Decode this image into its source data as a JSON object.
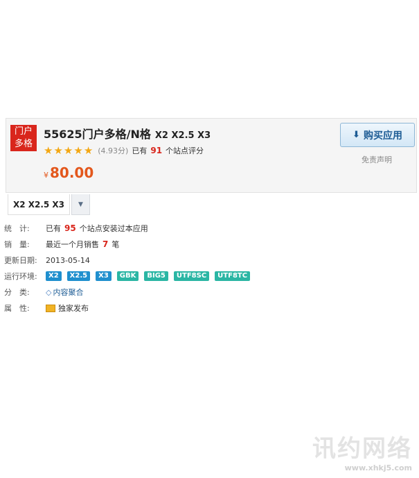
{
  "header": {
    "badge_lines": [
      "门户",
      "多格"
    ],
    "title": "55625门户多格/N格",
    "versions": "X2 X2.5 X3",
    "rating": {
      "stars": 5,
      "score_text": "(4.93分)",
      "prefix": "已有",
      "count": "91",
      "suffix": "个站点评分"
    },
    "price_currency": "¥",
    "price": "80.00",
    "buy_label": "购买应用",
    "buy_icon": "download-icon",
    "disclaimer": "免责声明"
  },
  "version_tab": {
    "label": "X2 X2.5 X3",
    "dropdown_icon": "chevron-down-icon"
  },
  "info": {
    "stats": {
      "label": "统　计:",
      "prefix": "已有",
      "count": "95",
      "suffix": "个站点安装过本应用"
    },
    "sales": {
      "label": "销　量:",
      "prefix": "最近一个月销售",
      "count": "7",
      "suffix": "笔"
    },
    "updated": {
      "label": "更新日期:",
      "value": "2013-05-14"
    },
    "env": {
      "label": "运行环境:",
      "tags": [
        {
          "text": "X2",
          "color": "#1f8fce"
        },
        {
          "text": "X2.5",
          "color": "#1f8fce"
        },
        {
          "text": "X3",
          "color": "#1f8fce"
        },
        {
          "text": "GBK",
          "color": "#2bb6a4"
        },
        {
          "text": "BIG5",
          "color": "#2bb6a4"
        },
        {
          "text": "UTF8SC",
          "color": "#2bb6a4"
        },
        {
          "text": "UTF8TC",
          "color": "#2bb6a4"
        }
      ]
    },
    "category": {
      "label": "分　类:",
      "value": "内容聚合",
      "icon": "tag-icon"
    },
    "attribute": {
      "label": "属　性:",
      "value": "独家发布",
      "icon": "exclusive-icon"
    }
  },
  "watermark": {
    "title": "讯约网络",
    "url": "www.xhkj5.com"
  },
  "colors": {
    "accent_red": "#d9261c",
    "price": "#e3571c",
    "link": "#1d5c95"
  }
}
